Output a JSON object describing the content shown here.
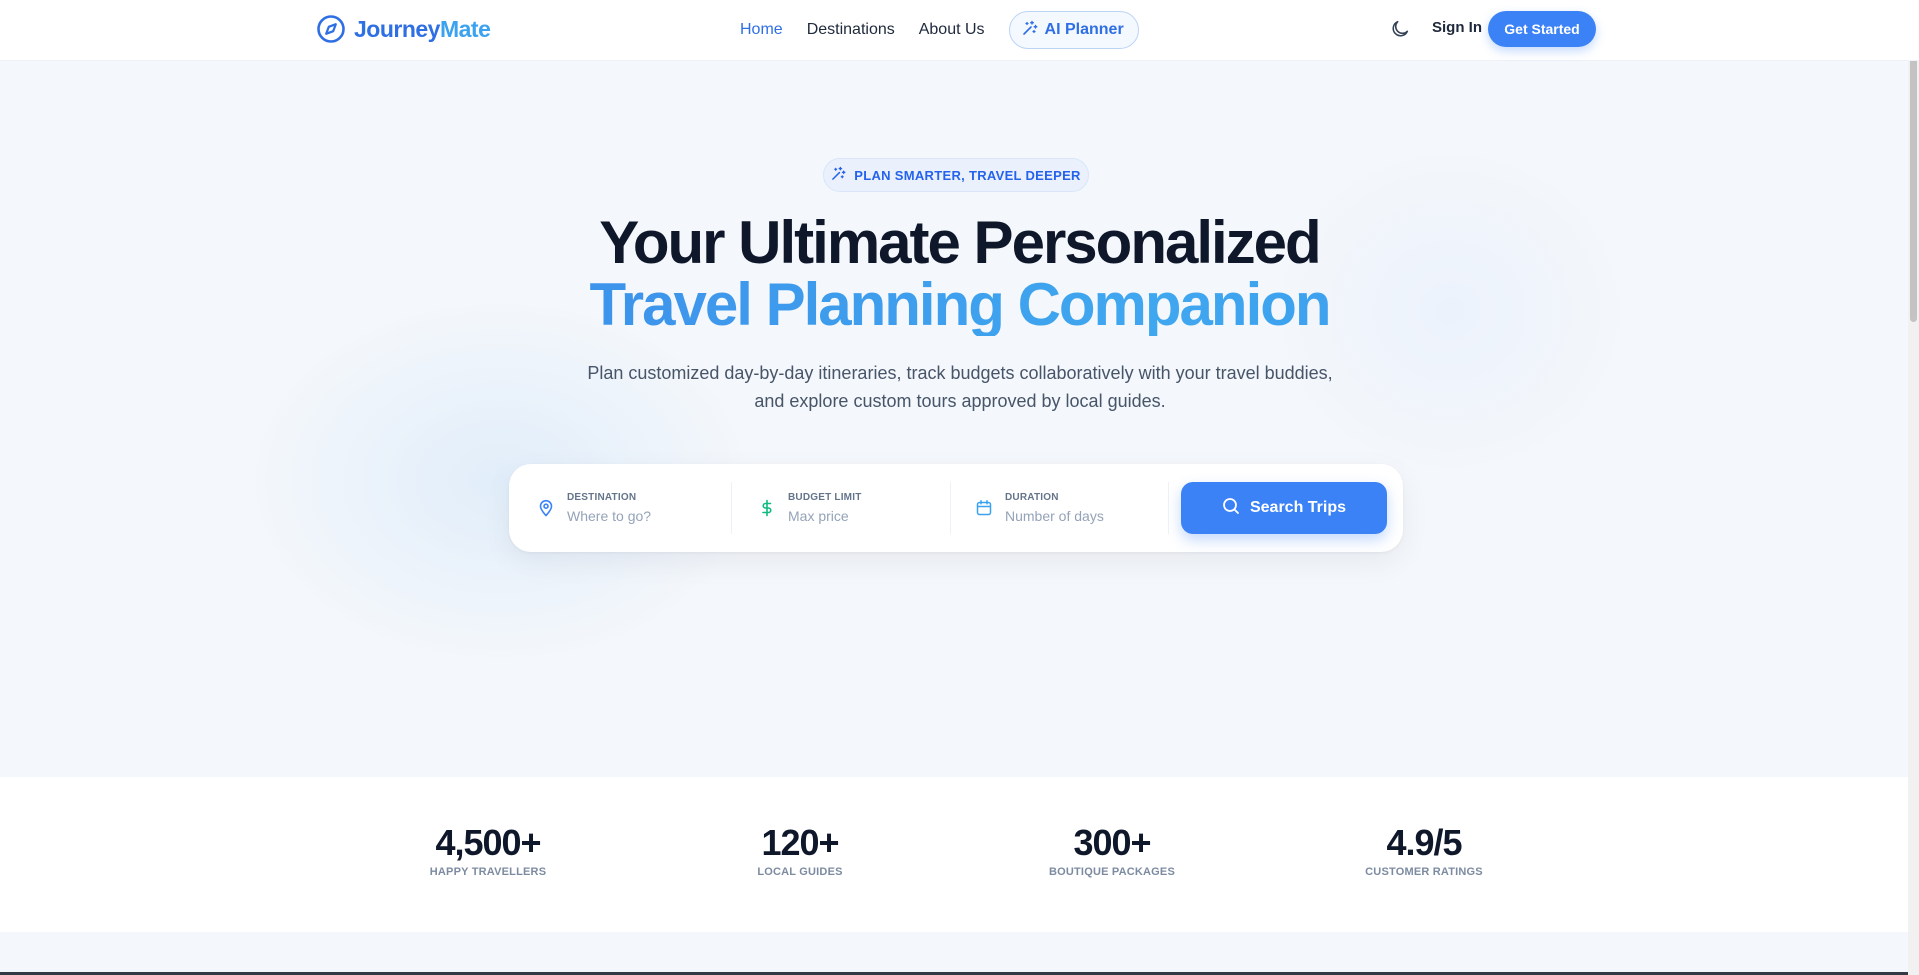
{
  "brand": {
    "name_part1": "Journey",
    "name_part2": "Mate",
    "icon": "compass-icon",
    "colors": {
      "primary": "#2f6fe4",
      "secondary": "#3ba2f0"
    }
  },
  "nav": {
    "links": [
      {
        "label": "Home",
        "active": true
      },
      {
        "label": "Destinations",
        "active": false
      },
      {
        "label": "About Us",
        "active": false
      }
    ],
    "ai_planner": {
      "label": "AI Planner",
      "icon": "sparkles-icon"
    },
    "theme_toggle_icon": "moon-icon",
    "sign_in": "Sign In",
    "get_started": "Get Started"
  },
  "hero": {
    "tagline": "PLAN SMARTER, TRAVEL DEEPER",
    "tagline_icon": "sparkles-icon",
    "headline_line1": "Your Ultimate Personalized",
    "headline_line2": "Travel Planning Companion",
    "subtitle_line1": "Plan customized day-by-day itineraries, track budgets collaboratively with your travel buddies,",
    "subtitle_line2": "and explore custom tours approved by local guides."
  },
  "search": {
    "destination": {
      "label": "DESTINATION",
      "placeholder": "Where to go?",
      "value": "",
      "icon": "map-pin-icon"
    },
    "budget": {
      "label": "BUDGET LIMIT",
      "placeholder": "Max price",
      "value": "",
      "icon": "dollar-icon"
    },
    "duration": {
      "label": "DURATION",
      "placeholder": "Number of days",
      "value": "",
      "icon": "calendar-icon"
    },
    "button": {
      "label": "Search Trips",
      "icon": "search-icon"
    }
  },
  "stats": [
    {
      "value": "4,500+",
      "label": "HAPPY TRAVELLERS"
    },
    {
      "value": "120+",
      "label": "LOCAL GUIDES"
    },
    {
      "value": "300+",
      "label": "BOUTIQUE PACKAGES"
    },
    {
      "value": "4.9/5",
      "label": "CUSTOMER RATINGS"
    }
  ],
  "colors": {
    "accent": "#3b82f6",
    "heading": "#0f172a",
    "muted": "#475569",
    "budget_icon": "#10b981"
  }
}
